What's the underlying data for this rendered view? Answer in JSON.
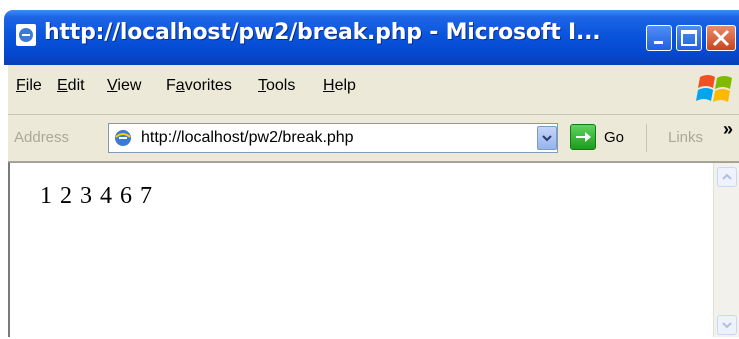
{
  "window": {
    "title": "http://localhost/pw2/break.php - Microsoft I..."
  },
  "menu": {
    "items": [
      {
        "underline": "F",
        "rest": "ile"
      },
      {
        "underline": "E",
        "rest": "dit"
      },
      {
        "underline": "V",
        "rest": "iew"
      },
      {
        "pre": "F",
        "underline": "a",
        "rest": "vorites"
      },
      {
        "underline": "T",
        "rest": "ools"
      },
      {
        "underline": "H",
        "rest": "elp"
      }
    ]
  },
  "address_bar": {
    "label": "Address",
    "url": "http://localhost/pw2/break.php",
    "go_label": "Go",
    "links_label": "Links",
    "chevron": "»"
  },
  "page": {
    "text": "1 2 3 4 6 7"
  },
  "colors": {
    "titlebar": "#0a55dd",
    "chrome": "#ece9d8",
    "go_green": "#1d9c1d"
  },
  "icons": {
    "title": "ie-icon",
    "address": "ie-icon",
    "logo": "windows-xp-logo",
    "go": "go-arrow-icon",
    "dropdown": "chevron-down-icon"
  }
}
